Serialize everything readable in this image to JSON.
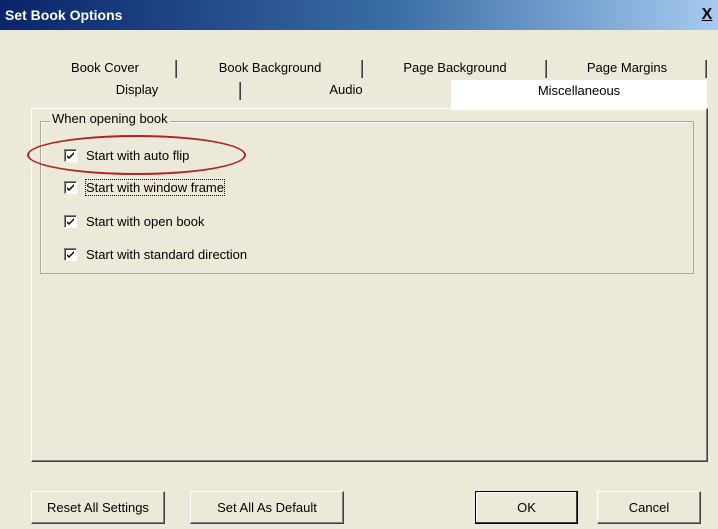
{
  "window": {
    "title": "Set Book Options",
    "close_label": "X"
  },
  "tabs": {
    "row1": [
      "Book Cover",
      "Book Background",
      "Page Background",
      "Page Margins"
    ],
    "row2": [
      "Display",
      "Audio",
      "Miscellaneous"
    ],
    "active": "Miscellaneous"
  },
  "group": {
    "label": "When opening book",
    "options": [
      {
        "label": "Start with auto flip",
        "checked": true
      },
      {
        "label": "Start with window frame",
        "checked": true
      },
      {
        "label": "Start with open book",
        "checked": true
      },
      {
        "label": "Start with standard direction",
        "checked": true
      }
    ]
  },
  "buttons": {
    "reset": "Reset All Settings",
    "set_default": "Set All As Default",
    "ok": "OK",
    "cancel": "Cancel"
  },
  "colors": {
    "annotation": "#b22222",
    "titlebar_start": "#0a246a",
    "titlebar_end": "#a6caf0"
  }
}
